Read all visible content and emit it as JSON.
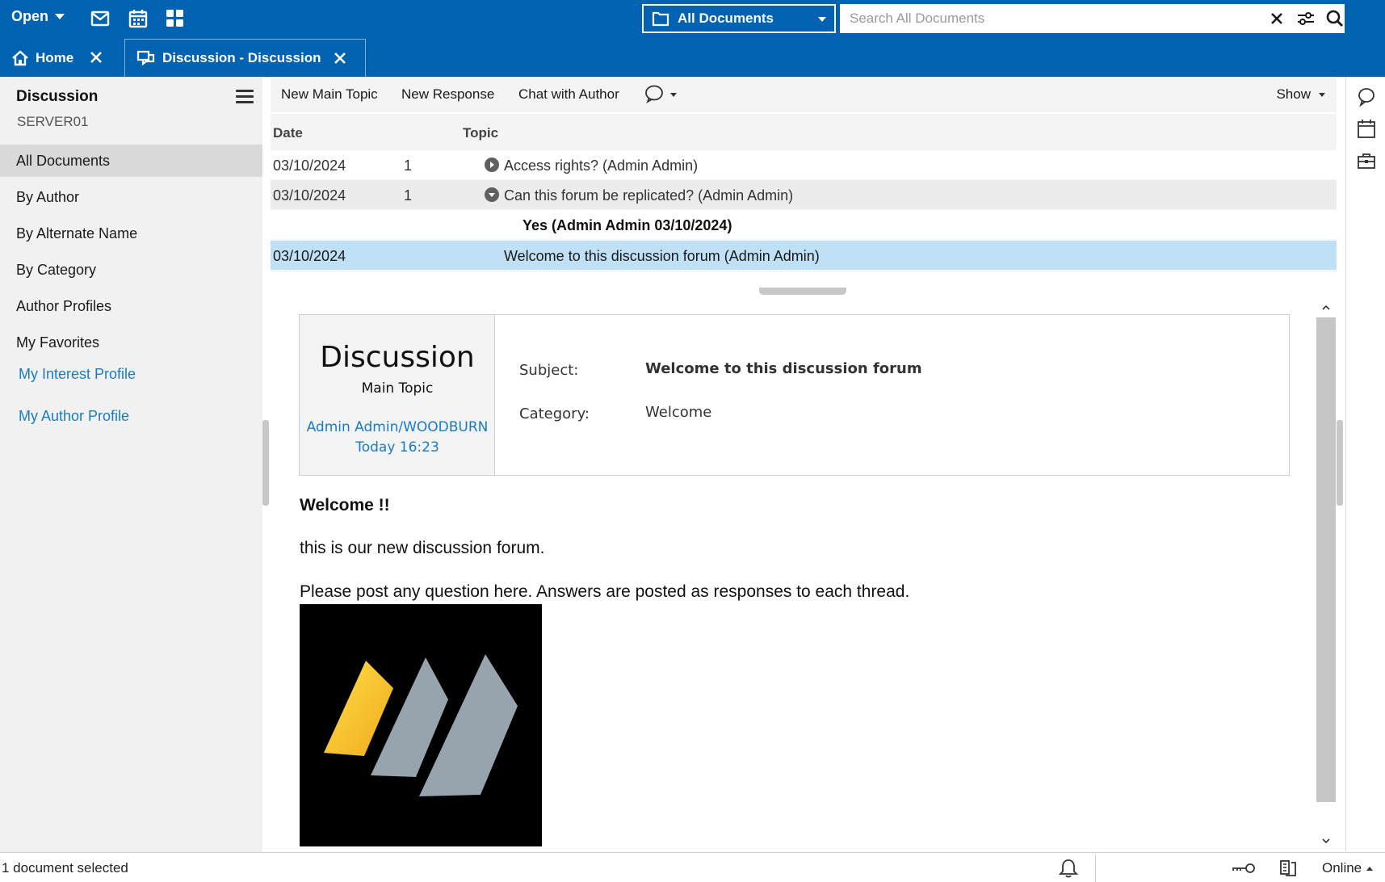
{
  "topbar": {
    "open_label": "Open",
    "icons": [
      "mail-icon",
      "calendar-icon",
      "apps-grid-icon"
    ],
    "scope": {
      "label": "All Documents"
    },
    "search": {
      "placeholder": "Search All Documents",
      "value": ""
    }
  },
  "tabs": [
    {
      "label": "Home",
      "icon": "home-icon"
    },
    {
      "label": "Discussion - Discussion",
      "icon": "discussion-icon",
      "active": true
    }
  ],
  "sidebar": {
    "title": "Discussion",
    "server": "SERVER01",
    "items": [
      {
        "label": "All Documents",
        "selected": true
      },
      {
        "label": "By Author"
      },
      {
        "label": "By Alternate Name"
      },
      {
        "label": "By Category"
      },
      {
        "label": "Author Profiles"
      },
      {
        "label": "My Favorites"
      }
    ],
    "links": [
      {
        "label": "My Interest Profile"
      },
      {
        "label": "My Author Profile"
      }
    ]
  },
  "toolbar": {
    "new_main_topic": "New Main Topic",
    "new_response": "New Response",
    "chat_with_author": "Chat with Author",
    "show": "Show"
  },
  "view": {
    "columns": {
      "date": "Date",
      "topic": "Topic"
    },
    "rows": [
      {
        "date": "03/10/2024",
        "count": "1",
        "topic": "Access rights? (Admin Admin)",
        "twisty": "expand"
      },
      {
        "date": "03/10/2024",
        "count": "1",
        "topic": "Can this forum be replicated? (Admin Admin)",
        "twisty": "collapse"
      },
      {
        "date": "",
        "count": "",
        "topic": "Yes  (Admin Admin 03/10/2024)",
        "response": true
      },
      {
        "date": "03/10/2024",
        "count": "",
        "topic": "Welcome to this discussion forum (Admin Admin)",
        "selected": true
      }
    ]
  },
  "document": {
    "form_title": "Discussion",
    "form_type": "Main Topic",
    "author": "Admin Admin/WOODBURN",
    "time": "Today 16:23",
    "subject_label": "Subject:",
    "subject": "Welcome to this discussion forum",
    "category_label": "Category:",
    "category": "Welcome",
    "body": {
      "heading": "Welcome !!",
      "line1": "this is our new discussion forum.",
      "line2": "Please post any question here. Answers are posted as responses to each thread."
    }
  },
  "statusbar": {
    "selection": "1 document selected",
    "online": "Online"
  },
  "colors": {
    "brand_blue": "#0062b1",
    "selected_row": "#bfe0f5",
    "link_blue": "#1a7bc4",
    "logo_yellow": "#f7c325",
    "logo_gray": "#98a4ad"
  }
}
